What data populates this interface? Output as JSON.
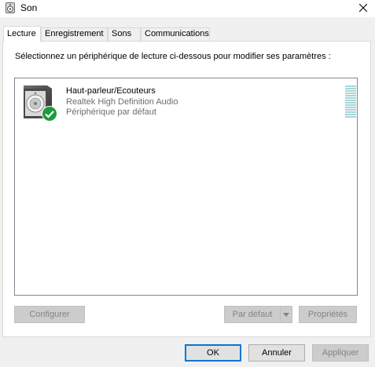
{
  "window": {
    "title": "Son"
  },
  "tabs": [
    {
      "label": "Lecture"
    },
    {
      "label": "Enregistrement"
    },
    {
      "label": "Sons"
    },
    {
      "label": "Communications"
    }
  ],
  "panel": {
    "instruction": "Sélectionnez un périphérique de lecture ci-dessous pour modifier ses paramètres :",
    "device": {
      "name": "Haut-parleur/Ecouteurs",
      "description": "Realtek High Definition Audio",
      "status": "Périphérique par défaut",
      "status_icon": "check-icon",
      "status_color": "#1e9a3b",
      "level_fraction": 0
    },
    "buttons": {
      "configure": "Configurer",
      "set_default": "Par défaut",
      "properties": "Propriétés"
    }
  },
  "footer": {
    "ok": "OK",
    "cancel": "Annuler",
    "apply": "Appliquer"
  },
  "colors": {
    "accent": "#0078d7",
    "meter": "#a6d6d9"
  }
}
